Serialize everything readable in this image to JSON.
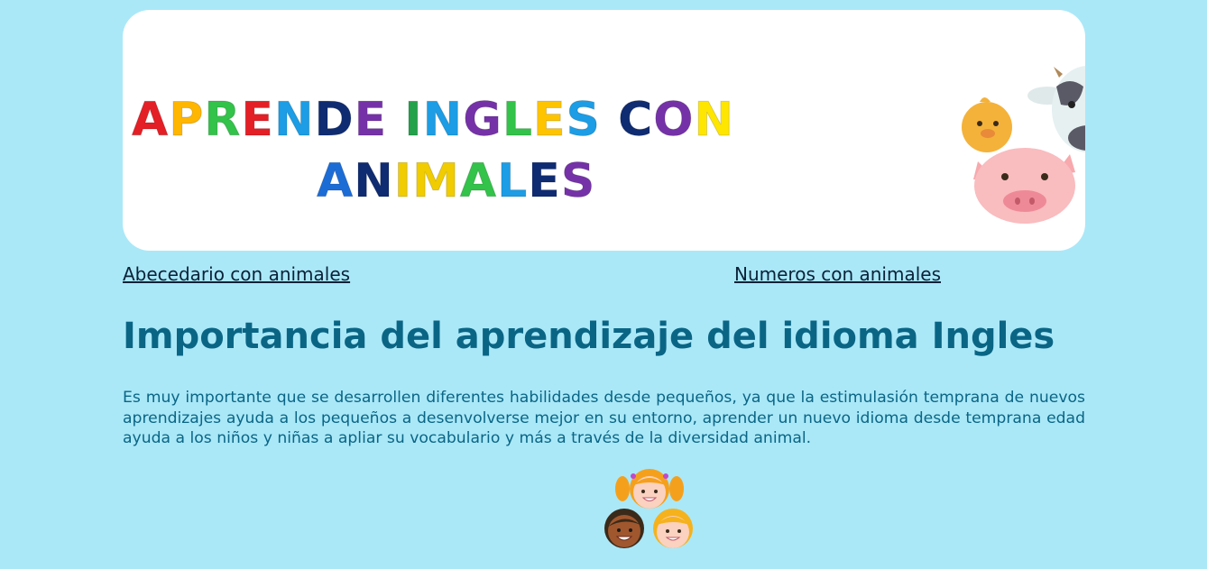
{
  "banner": {
    "line1": [
      "A",
      "P",
      "R",
      "E",
      "N",
      "D",
      "E",
      " ",
      "I",
      "N",
      "G",
      "L",
      "E",
      "S",
      " ",
      "C",
      "O",
      "N"
    ],
    "line1_colors": [
      "#e41f26",
      "#ffb600",
      "#33c24a",
      "#e41f26",
      "#1c9de5",
      "#0f2c72",
      "#7532a8",
      "#ffffff",
      "#23a14b",
      "#1c9de5",
      "#7532a8",
      "#33c24a",
      "#ffc400",
      "#1c9de5",
      "#ffffff",
      "#0f2c72",
      "#7532a8",
      "#ffe600"
    ],
    "line2": [
      "A",
      "N",
      "I",
      "M",
      "A",
      "L",
      "E",
      "S"
    ],
    "line2_colors": [
      "#1c6cd6",
      "#0f2c72",
      "#f0cc00",
      "#f0cc00",
      "#33c24a",
      "#1c9de5",
      "#0f2c72",
      "#7532a8"
    ],
    "animals": [
      "chick-icon",
      "cow-icon",
      "pig-icon",
      "chicken-icon"
    ]
  },
  "nav": {
    "link_alphabet": "Abecedario con animales",
    "link_numbers": "Numeros con animales"
  },
  "main": {
    "heading": "Importancia del aprendizaje del idioma Ingles",
    "paragraph": "Es muy importante que se desarrollen diferentes habilidades desde pequeños, ya que la estimulasión temprana de nuevos aprendizajes ayuda a los pequeños a desenvolverse mejor en su entorno, aprender un nuevo idioma desde temprana edad ayuda a los niños y niñas a apliar su vocabulario y más a través de la diversidad animal."
  },
  "footer_image": "kids-faces-icon"
}
